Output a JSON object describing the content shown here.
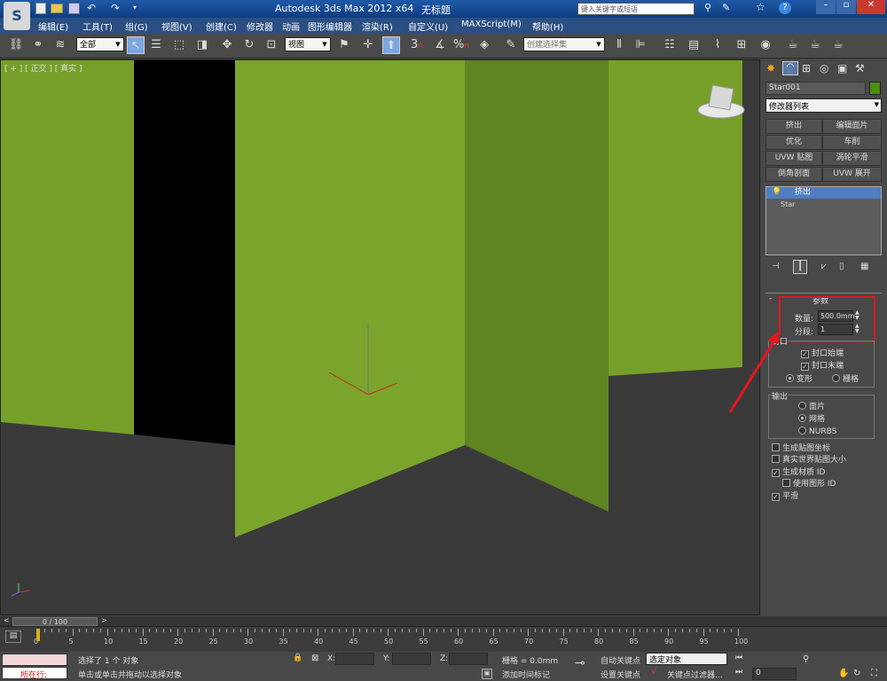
{
  "window": {
    "title": "Autodesk 3ds Max  2012 x64",
    "file": "无标题",
    "search_placeholder": "键入关键字或短语"
  },
  "menu": [
    "编辑(E)",
    "工具(T)",
    "组(G)",
    "视图(V)",
    "创建(C)",
    "修改器",
    "动画",
    "图形编辑器",
    "渲染(R)",
    "自定义(U)",
    "MAXScript(M)",
    "帮助(H)"
  ],
  "toolbar": {
    "selection_filter": "全部",
    "ref_coord": "视图",
    "named_selection": "创建选择集",
    "snap_labels": [
      "3",
      "n",
      "%",
      "n"
    ]
  },
  "viewport": {
    "label": "[ + ] [ 正交 ] [ 真实 ]"
  },
  "panel": {
    "object_name": "Star001",
    "modifier_list": "修改器列表",
    "mod_buttons": [
      "挤出",
      "编辑面片",
      "优化",
      "车削",
      "UVW 贴图",
      "涡轮平滑",
      "倒角剖面",
      "UVW 展开"
    ],
    "stack": [
      "挤出",
      "Star"
    ],
    "params_title": "参数",
    "amount_label": "数量:",
    "amount_value": "500.0mm",
    "segments_label": "分段:",
    "segments_value": "1",
    "capping_title": "封口",
    "cap_start": "封口始端",
    "cap_end": "封口末端",
    "morph": "变形",
    "grid": "栅格",
    "output_title": "输出",
    "patch": "面片",
    "mesh": "网格",
    "nurbs": "NURBS",
    "gen_map": "生成贴图坐标",
    "real_world": "真实世界贴图大小",
    "gen_matid": "生成材质 ID",
    "use_shape_id": "使用图形 ID",
    "smooth": "平滑"
  },
  "timeline": {
    "frame": "0 / 100",
    "ticks": [
      "0",
      "5",
      "10",
      "15",
      "20",
      "25",
      "30",
      "35",
      "40",
      "45",
      "50",
      "55",
      "60",
      "65",
      "70",
      "75",
      "80",
      "85",
      "90",
      "95",
      "100"
    ]
  },
  "status": {
    "running": "所在行:",
    "selected": "选择了 1 个 对象",
    "prompt": "单击或单击并拖动以选择对象",
    "x_label": "X:",
    "y_label": "Y:",
    "z_label": "Z:",
    "grid": "栅格 = 0.0mm",
    "add_time_tag": "添加时间标记",
    "auto_key": "自动关键点",
    "set_key": "设置关键点",
    "key_mode": "选定对象",
    "key_filter": "关键点过滤器...",
    "frame_value": "0"
  },
  "colors": {
    "green": "#76a02a",
    "highlight": "#e8141c"
  }
}
